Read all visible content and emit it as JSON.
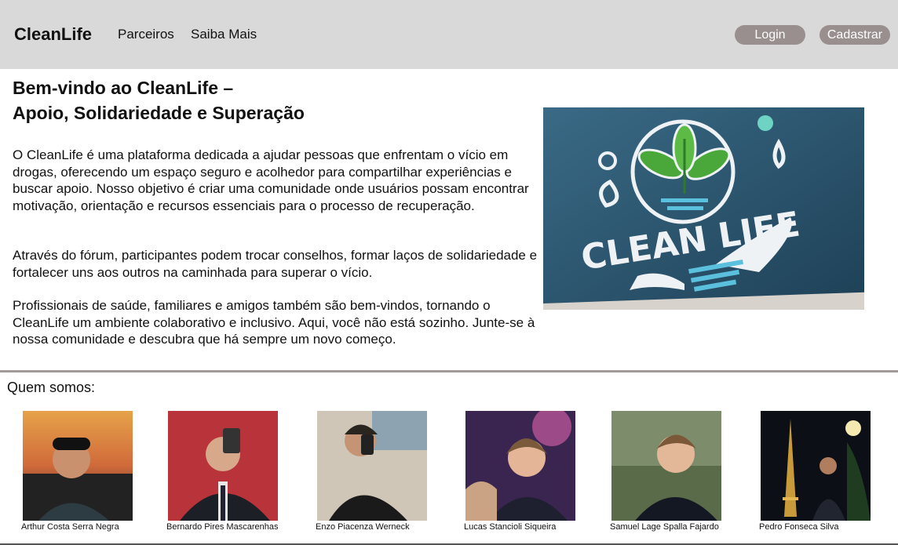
{
  "header": {
    "brand": "CleanLife",
    "nav": [
      "Parceiros",
      "Saiba Mais"
    ],
    "login_label": "Login",
    "signup_label": "Cadastrar"
  },
  "hero": {
    "title_line1": "Bem-vindo ao CleanLife –",
    "title_line2": "Apoio, Solidariedade e Superação",
    "paragraph1": "O CleanLife é uma plataforma dedicada a ajudar pessoas que enfrentam o vício em drogas, oferecendo um espaço seguro e acolhedor para compartilhar experiências e buscar apoio. Nosso objetivo é criar uma comunidade onde usuários possam encontrar motivação, orientação e recursos essenciais para o processo de recuperação.",
    "paragraph2": "Através do fórum, participantes podem trocar conselhos, formar laços de solidariedade e fortalecer uns aos outros na caminhada para superar o vício.",
    "paragraph3": "Profissionais de saúde, familiares e amigos também são bem-vindos, tornando o CleanLife um ambiente colaborativo e inclusivo. Aqui, você não está sozinho. Junte-se à nossa comunidade e descubra que há sempre um novo começo.",
    "logo_text": "CLEAN LIFE"
  },
  "team": {
    "title": "Quem somos:",
    "members": [
      {
        "name": "Arthur Costa Serra Negra"
      },
      {
        "name": "Bernardo Pires Mascarenhas"
      },
      {
        "name": "Enzo Piacenza Werneck"
      },
      {
        "name": "Lucas Stancioli Siqueira"
      },
      {
        "name": "Samuel Lage Spalla Fajardo"
      },
      {
        "name": "Pedro Fonseca Silva"
      }
    ]
  },
  "colors": {
    "header_bg": "#d9d9d9",
    "button_bg": "#9a8f8f",
    "logo_bg": "#2b5068",
    "leaf_green": "#4aa83a",
    "water_blue": "#5bc0de"
  }
}
